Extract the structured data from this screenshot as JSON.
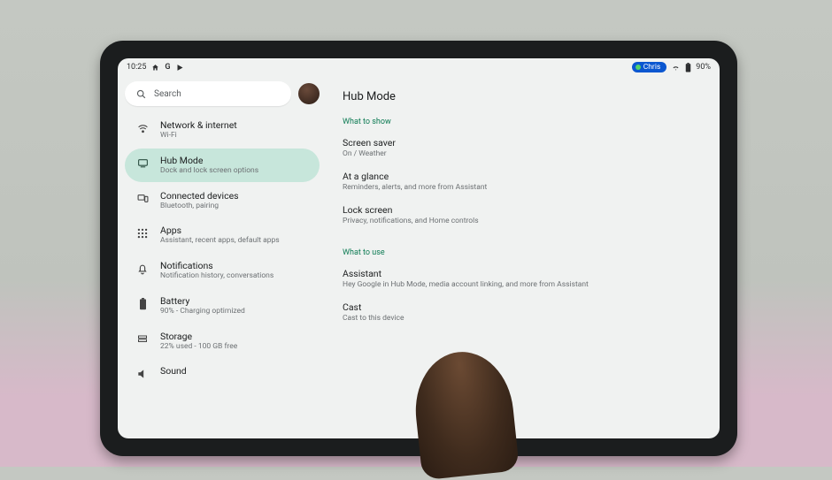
{
  "status": {
    "time": "10:25",
    "chip_label": "Chris",
    "battery_text": "90%"
  },
  "search": {
    "placeholder": "Search"
  },
  "sidebar": {
    "items": [
      {
        "title": "Network & internet",
        "sub": "Wi-Fi"
      },
      {
        "title": "Hub Mode",
        "sub": "Dock and lock screen options"
      },
      {
        "title": "Connected devices",
        "sub": "Bluetooth, pairing"
      },
      {
        "title": "Apps",
        "sub": "Assistant, recent apps, default apps"
      },
      {
        "title": "Notifications",
        "sub": "Notification history, conversations"
      },
      {
        "title": "Battery",
        "sub": "90% - Charging optimized"
      },
      {
        "title": "Storage",
        "sub": "22% used - 100 GB free"
      },
      {
        "title": "Sound",
        "sub": ""
      }
    ],
    "active_index": 1
  },
  "page": {
    "title": "Hub Mode",
    "sections": [
      {
        "label": "What to show",
        "items": [
          {
            "title": "Screen saver",
            "sub": "On / Weather"
          },
          {
            "title": "At a glance",
            "sub": "Reminders, alerts, and more from Assistant"
          },
          {
            "title": "Lock screen",
            "sub": "Privacy, notifications, and Home controls"
          }
        ]
      },
      {
        "label": "What to use",
        "items": [
          {
            "title": "Assistant",
            "sub": "Hey Google in Hub Mode, media account linking, and more from Assistant"
          },
          {
            "title": "Cast",
            "sub": "Cast to this device"
          }
        ]
      }
    ]
  }
}
